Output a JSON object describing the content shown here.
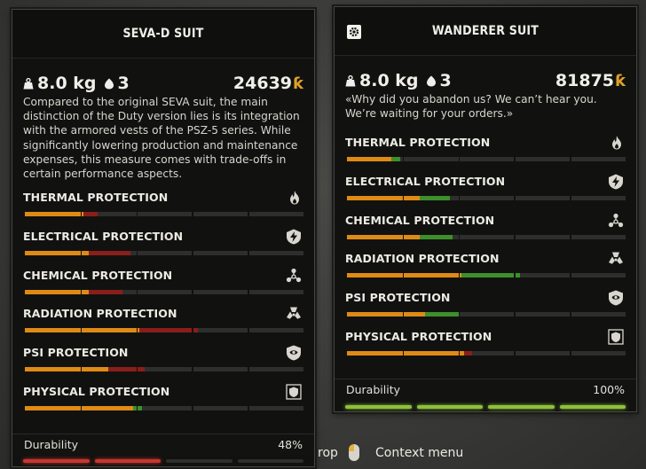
{
  "left_card": {
    "title": "SEVA-D SUIT",
    "weight": "8.0 kg",
    "slots": "3",
    "price": "24639",
    "currency_icon": "coupon-icon",
    "description": "Compared to the original SEVA suit, the main distinction of the Duty version lies is its integration with the armored vests of the PSZ-5 series. While significantly lowering production and maintenance expenses, this measure comes with trade-offs in certain performance aspects.",
    "protections": [
      {
        "label": "THERMAL PROTECTION",
        "icon": "fire-icon",
        "value": 0.21,
        "delta": -0.05
      },
      {
        "label": "ELECTRICAL PROTECTION",
        "icon": "lightning-icon",
        "value": 0.23,
        "delta": -0.15
      },
      {
        "label": "CHEMICAL PROTECTION",
        "icon": "biohazard-icon",
        "value": 0.23,
        "delta": -0.12
      },
      {
        "label": "RADIATION PROTECTION",
        "icon": "radiation-icon",
        "value": 0.41,
        "delta": -0.21
      },
      {
        "label": "PSI PROTECTION",
        "icon": "psi-shield-icon",
        "value": 0.3,
        "delta": -0.13
      },
      {
        "label": "PHYSICAL PROTECTION",
        "icon": "armor-shield-icon",
        "value": 0.39,
        "delta": 0.03
      }
    ],
    "durability_label": "Durability",
    "durability_value": "48%",
    "durability_fraction": 0.48,
    "durability_color": "#c8352f"
  },
  "right_card": {
    "title": "WANDERER SUIT",
    "settings_icon": "gear-icon",
    "weight": "8.0 kg",
    "slots": "3",
    "price": "81875",
    "currency_icon": "coupon-icon",
    "description": "«Why did you abandon us? We can’t hear you. We’re waiting for your orders.»",
    "protections": [
      {
        "label": "THERMAL PROTECTION",
        "icon": "fire-icon",
        "value": 0.16,
        "delta": 0.03
      },
      {
        "label": "ELECTRICAL PROTECTION",
        "icon": "lightning-icon",
        "value": 0.26,
        "delta": 0.11
      },
      {
        "label": "CHEMICAL PROTECTION",
        "icon": "biohazard-icon",
        "value": 0.26,
        "delta": 0.12
      },
      {
        "label": "RADIATION PROTECTION",
        "icon": "radiation-icon",
        "value": 0.41,
        "delta": 0.21
      },
      {
        "label": "PSI PROTECTION",
        "icon": "psi-shield-icon",
        "value": 0.28,
        "delta": 0.12
      },
      {
        "label": "PHYSICAL PROTECTION",
        "icon": "armor-shield-icon",
        "value": 0.42,
        "delta": -0.03
      }
    ],
    "durability_label": "Durability",
    "durability_value": "100%",
    "durability_fraction": 1.0,
    "durability_color": "#8fc03a"
  },
  "colors": {
    "fill": "#e08a16",
    "increase": "#3d8f2b",
    "decrease": "#8a1e1a",
    "track": "#2e2f2c"
  },
  "hints": {
    "drop": "rop",
    "context_menu": "Context menu",
    "mouse_icon": "mouse-right-click-icon"
  }
}
